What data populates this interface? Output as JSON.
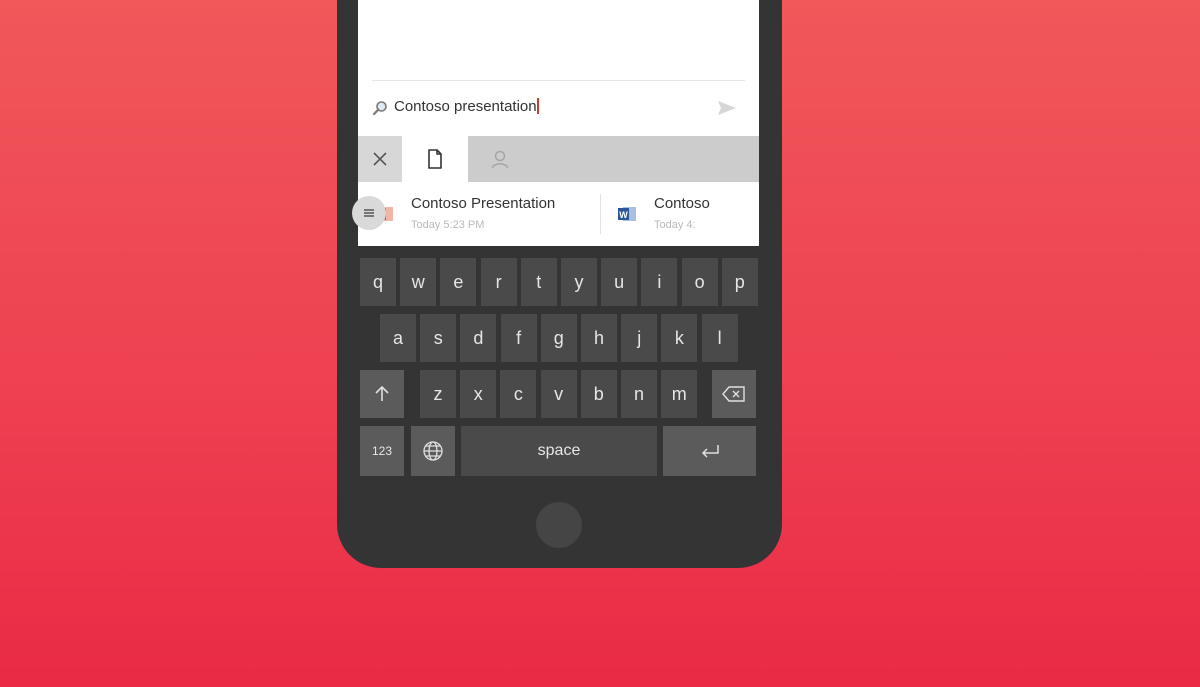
{
  "search": {
    "query": "Contoso presentation",
    "icon": "search-icon",
    "send_icon": "send-icon"
  },
  "tabs": [
    {
      "name": "close",
      "icon": "close-icon"
    },
    {
      "name": "files",
      "icon": "document-icon",
      "selected": true
    },
    {
      "name": "people",
      "icon": "person-icon"
    }
  ],
  "results": [
    {
      "title": "Contoso Presentation",
      "subtitle": "Today 5:23 PM",
      "icon": "powerpoint-icon",
      "color": "#d24726"
    },
    {
      "title": "Contoso",
      "subtitle": "Today 4:",
      "icon": "word-icon",
      "color": "#2b579a"
    }
  ],
  "keyboard": {
    "row1": [
      "q",
      "w",
      "e",
      "r",
      "t",
      "y",
      "u",
      "i",
      "o",
      "p"
    ],
    "row2": [
      "a",
      "s",
      "d",
      "f",
      "g",
      "h",
      "j",
      "k",
      "l"
    ],
    "row3": [
      "z",
      "x",
      "c",
      "v",
      "b",
      "n",
      "m"
    ],
    "shift_icon": "shift-arrow-icon",
    "backspace_icon": "backspace-icon",
    "numbers_label": "123",
    "globe_icon": "globe-icon",
    "space_label": "space",
    "enter_icon": "enter-icon"
  },
  "colors": {
    "accent": "#ee4151",
    "phone_body": "#343434",
    "key": "#4a4a4a"
  }
}
